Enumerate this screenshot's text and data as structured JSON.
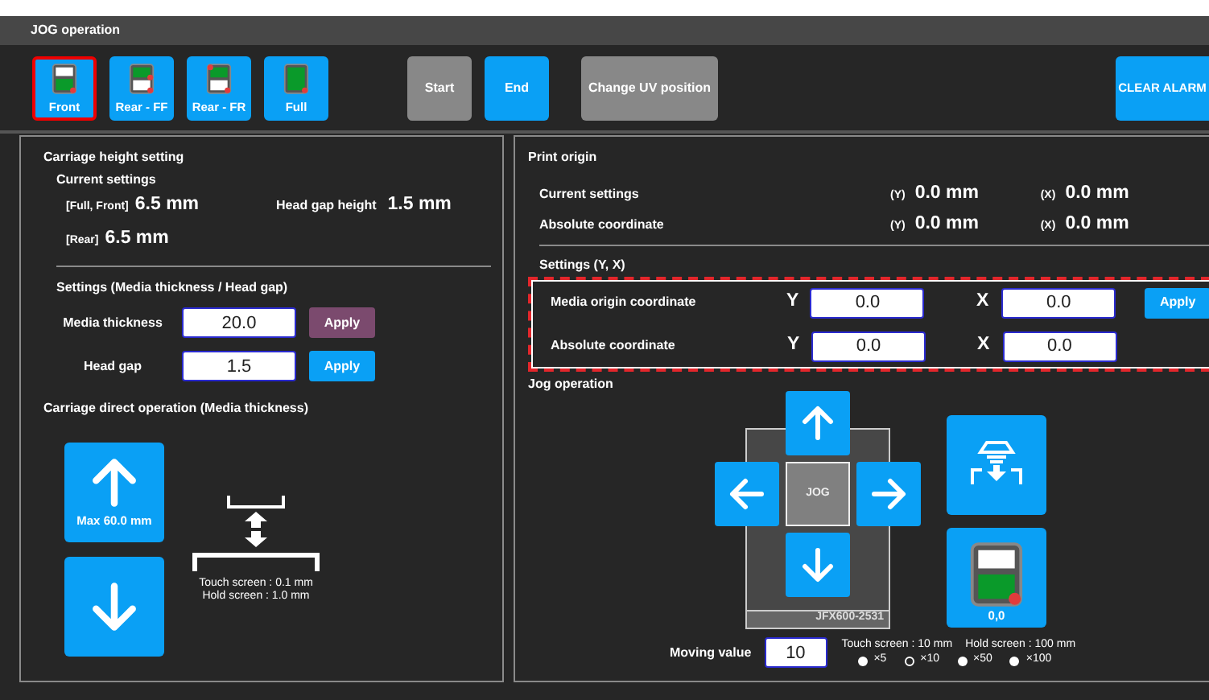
{
  "window": {
    "title": "JOG operation"
  },
  "toolbar": {
    "origin_buttons": [
      {
        "label": "Front",
        "kind": "front",
        "selected": true
      },
      {
        "label": "Rear - FF",
        "kind": "rear_ff",
        "selected": false
      },
      {
        "label": "Rear - FR",
        "kind": "rear_fr",
        "selected": false
      },
      {
        "label": "Full",
        "kind": "full",
        "selected": false
      }
    ],
    "actions": [
      {
        "label": "Start",
        "disabled": true
      },
      {
        "label": "End",
        "disabled": false
      },
      {
        "label": "Change UV position",
        "disabled": true
      }
    ],
    "clear_alarm": "CLEAR ALARM"
  },
  "carriage": {
    "title": "Carriage height setting",
    "current_title": "Current settings",
    "full_front_label": "[Full, Front]",
    "full_front_value": "6.5 mm",
    "head_gap_label": "Head gap height",
    "head_gap_value": "1.5 mm",
    "rear_label": "[Rear]",
    "rear_value": "6.5 mm",
    "settings_title": "Settings (Media thickness / Head gap)",
    "fields": [
      {
        "label": "Media thickness",
        "value": "20.0",
        "apply": "Apply",
        "active": true
      },
      {
        "label": "Head gap",
        "value": "1.5",
        "apply": "Apply",
        "active": false
      }
    ],
    "direct_title": "Carriage direct operation (Media thickness)",
    "max_label": "Max 60.0 mm",
    "touch_note": "Touch screen : 0.1 mm",
    "hold_note": "Hold screen : 1.0 mm"
  },
  "print_origin": {
    "title": "Print origin",
    "readings": [
      {
        "label": "Current settings",
        "y_tag": "(Y)",
        "y_value": "0.0 mm",
        "x_tag": "(X)",
        "x_value": "0.0 mm"
      },
      {
        "label": "Absolute coordinate",
        "y_tag": "(Y)",
        "y_value": "0.0 mm",
        "x_tag": "(X)",
        "x_value": "0.0 mm"
      }
    ],
    "settings_title": "Settings (Y, X)",
    "rows": [
      {
        "label": "Media origin coordinate",
        "y_axis": "Y",
        "y_value": "0.0",
        "x_axis": "X",
        "x_value": "0.0",
        "apply": "Apply"
      },
      {
        "label": "Absolute coordinate",
        "y_axis": "Y",
        "y_value": "0.0",
        "x_axis": "X",
        "x_value": "0.0"
      }
    ]
  },
  "jog": {
    "title": "Jog operation",
    "center_label": "JOG",
    "model": "JFX600-2531",
    "origin_label": "0,0",
    "moving_label": "Moving value",
    "moving_value": "10",
    "touch_note": "Touch screen : 10 mm",
    "hold_note": "Hold screen : 100 mm",
    "multipliers": [
      {
        "label": "×5",
        "selected": false
      },
      {
        "label": "×10",
        "selected": true
      },
      {
        "label": "×50",
        "selected": false
      },
      {
        "label": "×100",
        "selected": false
      }
    ]
  }
}
